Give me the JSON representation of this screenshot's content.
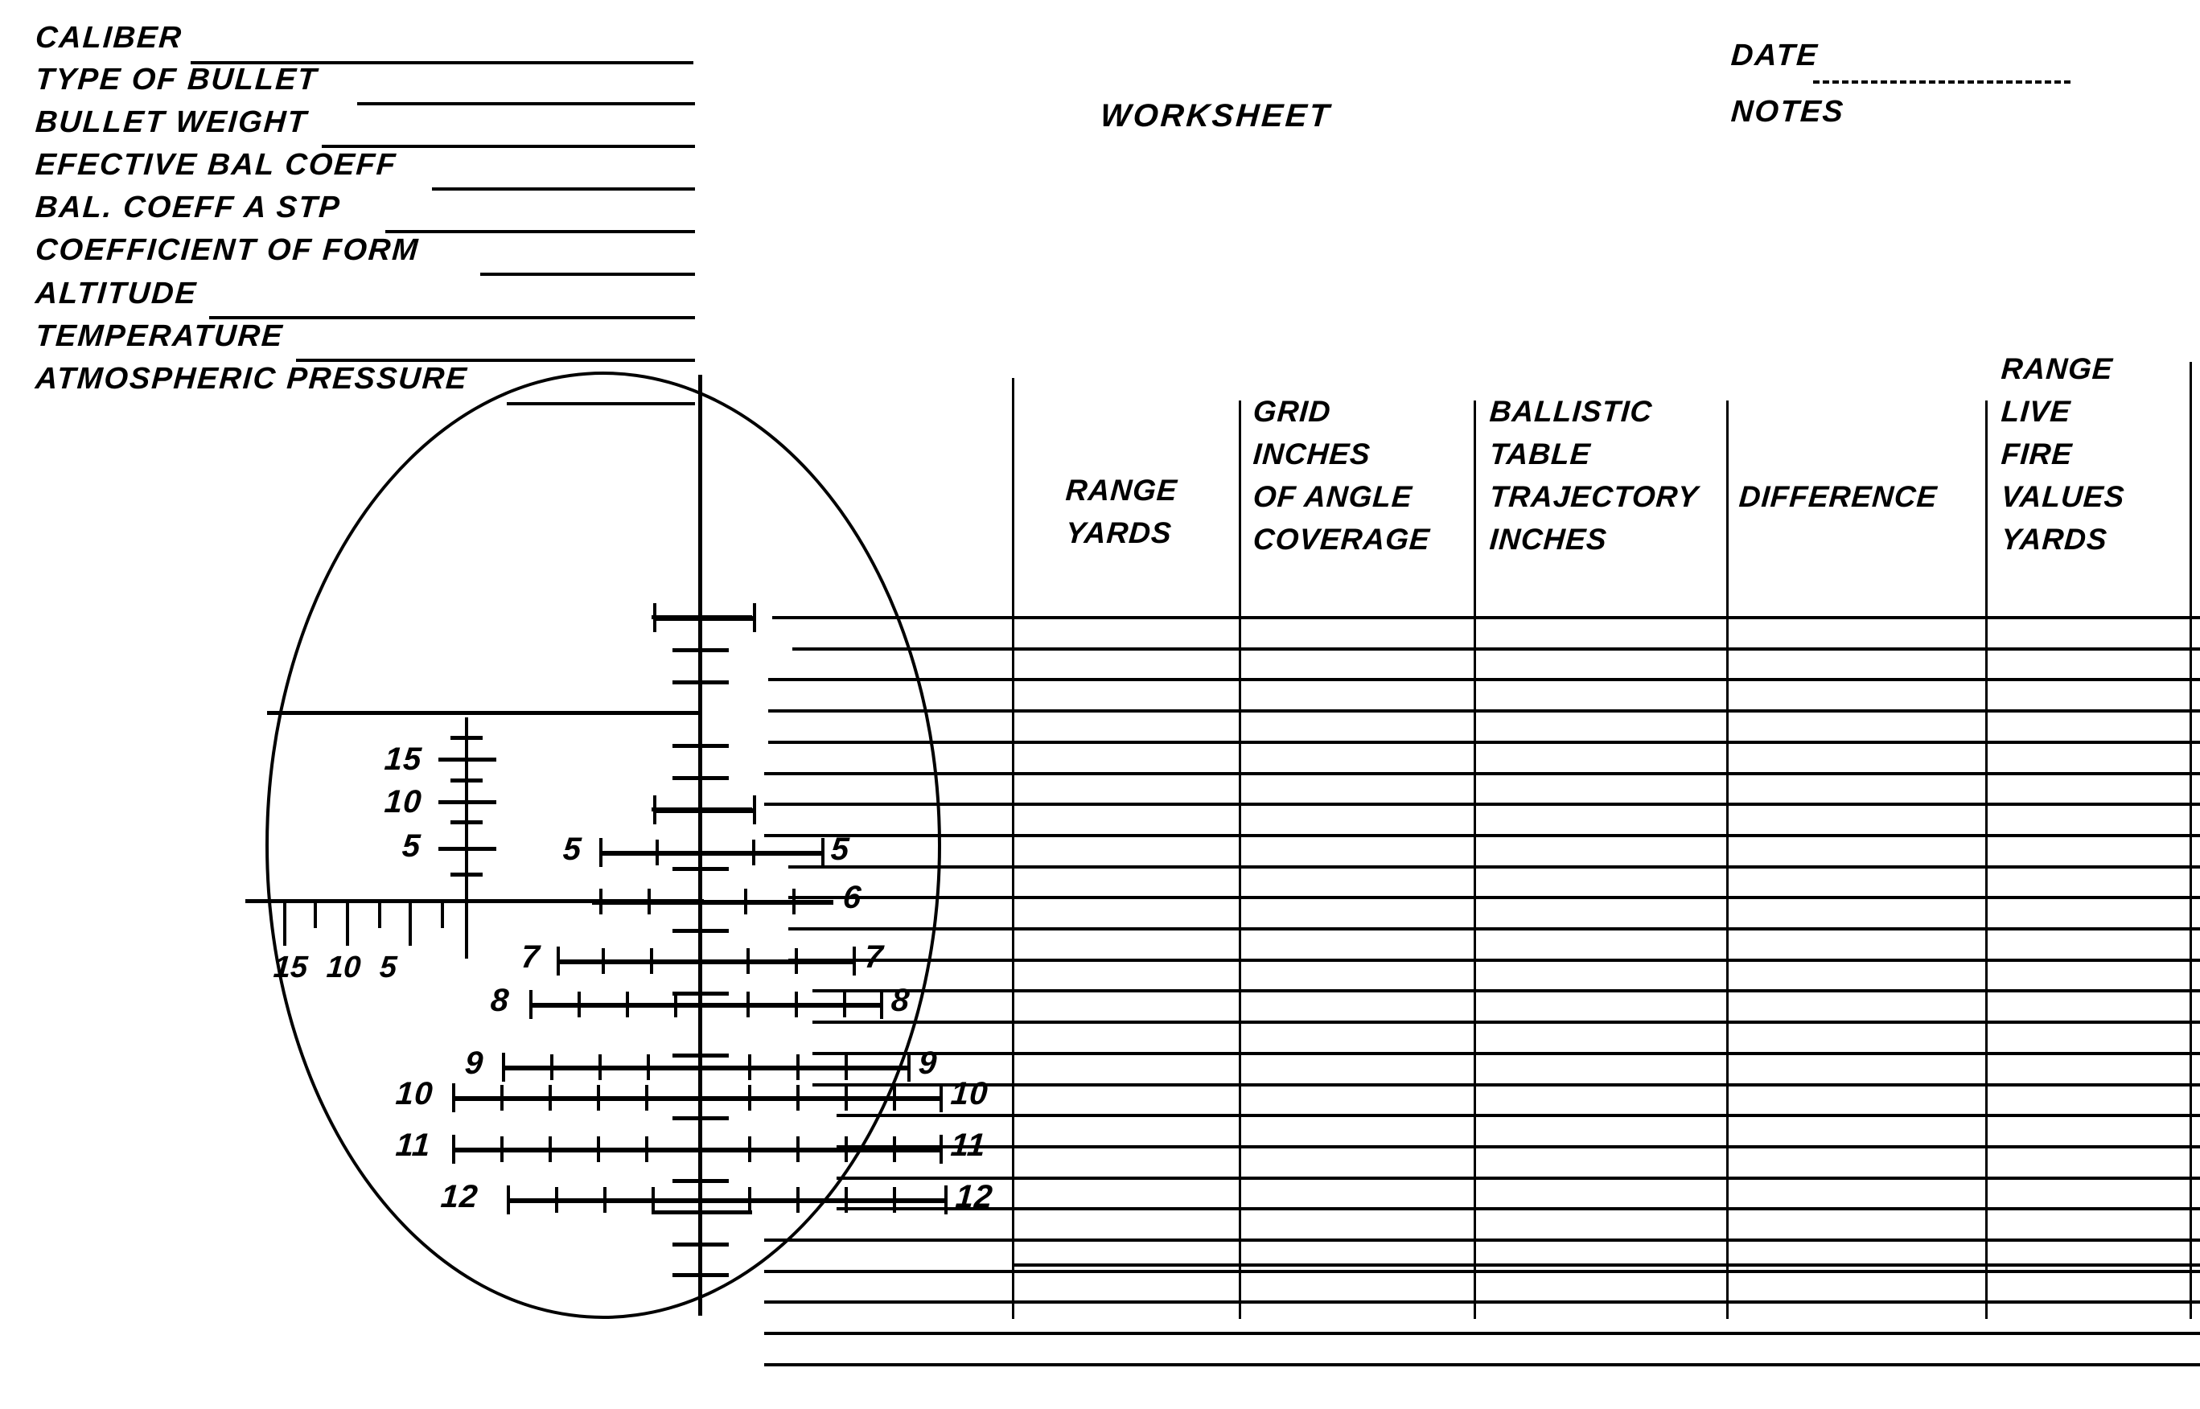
{
  "document": {
    "title": "WORKSHEET",
    "type": "ballistic-reticle-worksheet"
  },
  "form_fields": [
    {
      "label": "CALIBER"
    },
    {
      "label": "TYPE OF BULLET"
    },
    {
      "label": "BULLET WEIGHT"
    },
    {
      "label": "EFECTIVE BAL COEFF"
    },
    {
      "label": "BAL. COEFF A STP"
    },
    {
      "label": "COEFFICIENT OF FORM"
    },
    {
      "label": "ALTITUDE"
    },
    {
      "label": "TEMPERATURE"
    },
    {
      "label": "ATMOSPHERIC PRESSURE"
    }
  ],
  "header": {
    "worksheet_title": "WORKSHEET",
    "date_label": "DATE",
    "notes_label": "NOTES"
  },
  "table": {
    "columns": [
      {
        "lines": [
          "RANGE",
          "YARDS"
        ]
      },
      {
        "lines": [
          "GRID",
          "INCHES",
          "OF ANGLE",
          "COVERAGE"
        ]
      },
      {
        "lines": [
          "BALLISTIC",
          "TABLE",
          "TRAJECTORY",
          "INCHES"
        ]
      },
      {
        "lines": [
          "DIFFERENCE"
        ]
      },
      {
        "lines": [
          "RANGE",
          "LIVE",
          "FIRE",
          "VALUES",
          "YARDS"
        ]
      }
    ],
    "row_count": 25
  },
  "reticle": {
    "vertical_scale_labels": [
      "15",
      "10",
      "5"
    ],
    "horizontal_scale_labels": [
      "15",
      "10",
      "5"
    ],
    "stadia_left_labels": [
      "5",
      "7",
      "8",
      "9",
      "10",
      "11",
      "12"
    ],
    "stadia_right_labels": [
      "5",
      "6",
      "7",
      "8",
      "9",
      "10",
      "11",
      "12"
    ]
  },
  "colors": {
    "ink": "#000000",
    "paper": "#ffffff"
  }
}
